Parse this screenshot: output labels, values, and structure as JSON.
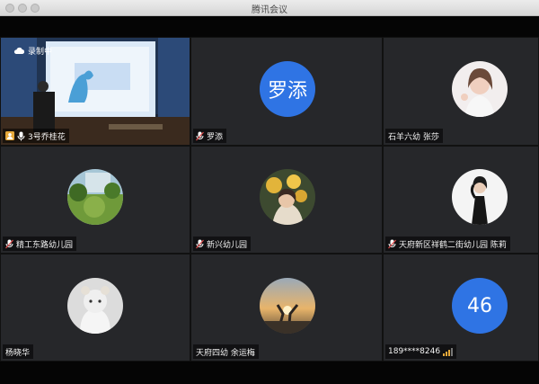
{
  "window": {
    "title": "腾讯会议"
  },
  "recording": {
    "label": "录制中"
  },
  "participants": [
    {
      "name": "3号乔桂花",
      "type": "video"
    },
    {
      "name": "罗添",
      "type": "text-avatar",
      "avatar_text": "罗添"
    },
    {
      "name": "石羊六幼 张莎",
      "type": "photo-avatar"
    },
    {
      "name": "精工东路幼儿园",
      "type": "photo-avatar"
    },
    {
      "name": "新兴幼儿园",
      "type": "photo-avatar"
    },
    {
      "name": "天府新区祥鹤二街幼儿园 陈莉",
      "type": "photo-avatar"
    },
    {
      "name": "杨晓华",
      "type": "photo-avatar"
    },
    {
      "name": "天府四幼 余运梅",
      "type": "photo-avatar"
    },
    {
      "name": "189****8246",
      "type": "text-avatar",
      "avatar_text": "46"
    }
  ],
  "colors": {
    "avatar_blue": "#2f74e4",
    "tile_bg": "#26272a",
    "host_icon": "#e8a93a"
  }
}
